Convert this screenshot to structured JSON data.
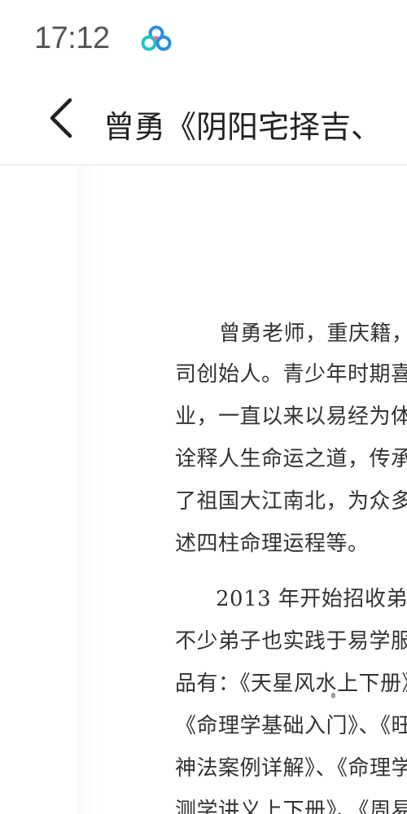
{
  "status_bar": {
    "time": "17:12",
    "app_icon": "cloud-rings-icon"
  },
  "header": {
    "back_icon": "chevron-left-icon",
    "title": "曾勇《阴阳宅择吉、"
  },
  "document": {
    "lines": [
      "曾勇老师，重庆籍，",
      "司创始人。青少年时期喜",
      "业，一直以来以易经为体",
      "诠释人生命运之道，传承",
      "了祖国大江南北，为众多",
      "述四柱命理运程等。",
      "2013 年开始招收弟子",
      "不少弟子也实践于易学服",
      "品有：《天星风水上下册》",
      "《命理学基础入门》、《旺",
      "神法案例详解》、《命理学",
      "测学讲义上下册》、《周易"
    ]
  },
  "colors": {
    "icon_blue": "#2b8fe0",
    "icon_teal": "#23c3c8",
    "icon_pink": "#f06a8e",
    "text_dark": "#222222",
    "status_gray": "#555555"
  }
}
